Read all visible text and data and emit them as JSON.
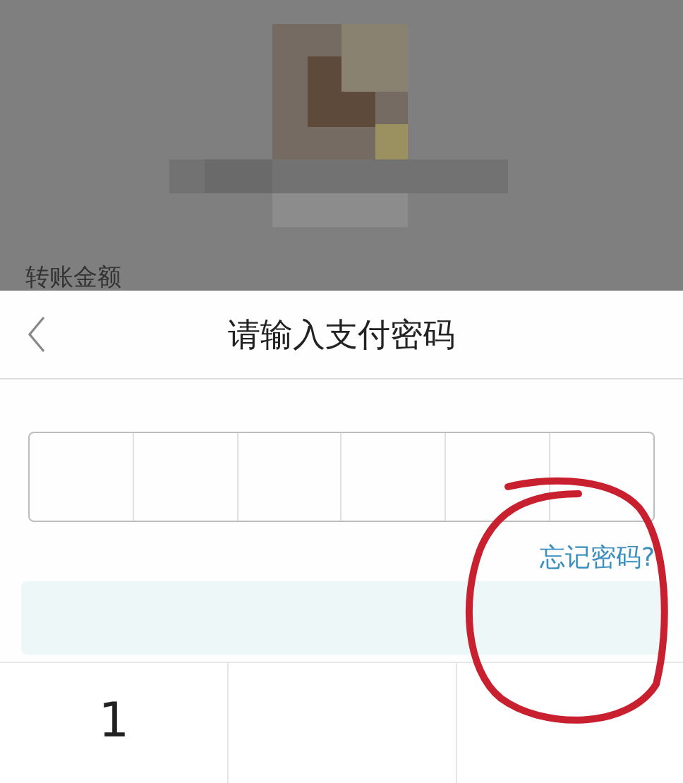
{
  "background": {
    "amount_label": "转账金额"
  },
  "sheet": {
    "title": "请输入支付密码",
    "forgot_link": "忘记密码?",
    "confirm_button": {
      "disabled": true
    },
    "keypad": {
      "keys": [
        "1"
      ]
    }
  }
}
